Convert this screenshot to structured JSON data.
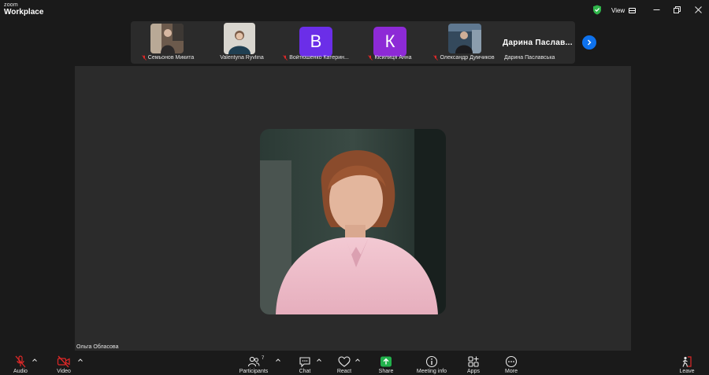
{
  "app": {
    "logo_top": "zoom",
    "logo_bottom": "Workplace"
  },
  "titlebar": {
    "view_label": "View"
  },
  "colors": {
    "background": "#1a1a1a",
    "panel": "#2b2b2b",
    "accent": "#0e72ed",
    "muted_red": "#e02828",
    "avatar_v": "#6b2ee8",
    "avatar_k": "#8d2ad6",
    "share_green": "#22b14c",
    "secure_green": "#2fb54a"
  },
  "participants_strip": [
    {
      "name": "Семьонов Микита",
      "muted": true,
      "kind": "video"
    },
    {
      "name": "Valentyna Ryvlina",
      "muted": false,
      "kind": "video"
    },
    {
      "name": "Войтюшенко Катерин...",
      "muted": true,
      "kind": "avatar",
      "initial": "В"
    },
    {
      "name": "Кісилиця Анна",
      "muted": true,
      "kind": "avatar",
      "initial": "К"
    },
    {
      "name": "Олександр Думчиков",
      "muted": true,
      "kind": "video"
    },
    {
      "name": "Дарина Паславська",
      "muted": false,
      "kind": "name-only",
      "big_name": "Дарина  Паслав..."
    }
  ],
  "stage": {
    "speaker_name": "Ольга Обласова"
  },
  "toolbar": {
    "audio": "Audio",
    "video": "Video",
    "participants": "Participants",
    "participants_count": "7",
    "chat": "Chat",
    "react": "React",
    "share": "Share",
    "meeting_info": "Meeting info",
    "apps": "Apps",
    "more": "More",
    "leave": "Leave"
  }
}
